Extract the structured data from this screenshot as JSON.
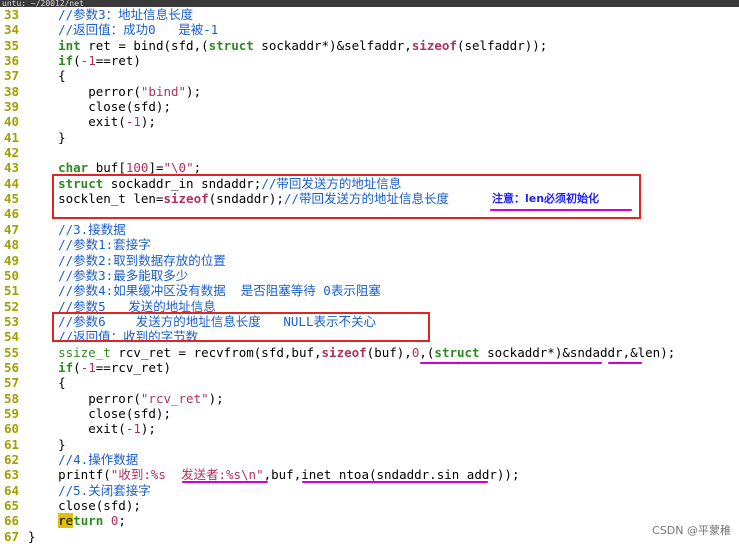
{
  "window": {
    "title": "untu: ~/20012/net"
  },
  "colors": {
    "line_number": "#a0a000",
    "comment": "#1a5fd0",
    "keyword": "#2e8b20",
    "string": "#b03060",
    "annotation_box": "#e02424",
    "annotation_underline": "#d000d0",
    "note_text": "#2020ff"
  },
  "lines": [
    {
      "n": "33",
      "segs": [
        [
          "t",
          "    "
        ],
        [
          "c",
          "//参数3：地址信息长度"
        ]
      ]
    },
    {
      "n": "34",
      "segs": [
        [
          "t",
          "    "
        ],
        [
          "c",
          "//返回值：成功0   是被-1"
        ]
      ]
    },
    {
      "n": "35",
      "segs": [
        [
          "t",
          "    "
        ],
        [
          "k",
          "int"
        ],
        [
          "t",
          " ret = bind(sfd,("
        ],
        [
          "k",
          "struct"
        ],
        [
          "t",
          " sockaddr*)&selfaddr,"
        ],
        [
          "f",
          "sizeof"
        ],
        [
          "t",
          "(selfaddr));"
        ]
      ]
    },
    {
      "n": "36",
      "segs": [
        [
          "t",
          "    "
        ],
        [
          "k",
          "if"
        ],
        [
          "t",
          "("
        ],
        [
          "n",
          "-1"
        ],
        [
          "t",
          "==ret)"
        ]
      ]
    },
    {
      "n": "37",
      "segs": [
        [
          "t",
          "    {"
        ]
      ]
    },
    {
      "n": "38",
      "segs": [
        [
          "t",
          "        perror("
        ],
        [
          "s",
          "\"bind\""
        ],
        [
          "t",
          ");"
        ]
      ]
    },
    {
      "n": "39",
      "segs": [
        [
          "t",
          "        close(sfd);"
        ]
      ]
    },
    {
      "n": "40",
      "segs": [
        [
          "t",
          "        exit("
        ],
        [
          "n",
          "-1"
        ],
        [
          "t",
          ");"
        ]
      ]
    },
    {
      "n": "41",
      "segs": [
        [
          "t",
          "    }"
        ]
      ]
    },
    {
      "n": "42",
      "segs": []
    },
    {
      "n": "43",
      "segs": [
        [
          "t",
          "    "
        ],
        [
          "k",
          "char"
        ],
        [
          "t",
          " buf["
        ],
        [
          "n",
          "100"
        ],
        [
          "t",
          "]="
        ],
        [
          "s",
          "\"\\0\""
        ],
        [
          "t",
          ";"
        ]
      ]
    },
    {
      "n": "44",
      "segs": [
        [
          "t",
          "    "
        ],
        [
          "k",
          "struct"
        ],
        [
          "t",
          " sockaddr_in sndaddr;"
        ],
        [
          "c",
          "//带回发送方的地址信息"
        ]
      ]
    },
    {
      "n": "45",
      "segs": [
        [
          "t",
          "    socklen_t len="
        ],
        [
          "f",
          "sizeof"
        ],
        [
          "t",
          "(sndaddr);"
        ],
        [
          "c",
          "//带回发送方的地址信息长度"
        ]
      ]
    },
    {
      "n": "46",
      "segs": []
    },
    {
      "n": "47",
      "segs": [
        [
          "t",
          "    "
        ],
        [
          "c",
          "//3.接数据"
        ]
      ]
    },
    {
      "n": "48",
      "segs": [
        [
          "t",
          "    "
        ],
        [
          "c",
          "//参数1:套接字"
        ]
      ]
    },
    {
      "n": "49",
      "segs": [
        [
          "t",
          "    "
        ],
        [
          "c",
          "//参数2:取到数据存放的位置"
        ]
      ]
    },
    {
      "n": "50",
      "segs": [
        [
          "t",
          "    "
        ],
        [
          "c",
          "//参数3:最多能取多少"
        ]
      ]
    },
    {
      "n": "51",
      "segs": [
        [
          "t",
          "    "
        ],
        [
          "c",
          "//参数4:如果缓冲区没有数据  是否阻塞等待 0表示阻塞"
        ]
      ]
    },
    {
      "n": "52",
      "segs": [
        [
          "t",
          "    "
        ],
        [
          "c",
          "//参数5   发送的地址信息"
        ]
      ]
    },
    {
      "n": "53",
      "segs": [
        [
          "t",
          "    "
        ],
        [
          "c",
          "//参数6    发送方的地址信息长度   NULL表示不关心"
        ]
      ]
    },
    {
      "n": "54",
      "segs": [
        [
          "t",
          "    "
        ],
        [
          "c",
          "//返回值：收到的字节数"
        ]
      ]
    },
    {
      "n": "55",
      "segs": [
        [
          "t",
          "    "
        ],
        [
          "y",
          "ssize_t"
        ],
        [
          "t",
          " rcv_ret = recvfrom(sfd,buf,"
        ],
        [
          "f",
          "sizeof"
        ],
        [
          "t",
          "(buf),"
        ],
        [
          "n",
          "0"
        ],
        [
          "t",
          ",("
        ],
        [
          "k",
          "struct"
        ],
        [
          "t",
          " sockaddr*)&sndaddr,&len);"
        ]
      ]
    },
    {
      "n": "56",
      "segs": [
        [
          "t",
          "    "
        ],
        [
          "k",
          "if"
        ],
        [
          "t",
          "("
        ],
        [
          "n",
          "-1"
        ],
        [
          "t",
          "==rcv_ret)"
        ]
      ]
    },
    {
      "n": "57",
      "segs": [
        [
          "t",
          "    {"
        ]
      ]
    },
    {
      "n": "58",
      "segs": [
        [
          "t",
          "        perror("
        ],
        [
          "s",
          "\"rcv_ret\""
        ],
        [
          "t",
          ");"
        ]
      ]
    },
    {
      "n": "59",
      "segs": [
        [
          "t",
          "        close(sfd);"
        ]
      ]
    },
    {
      "n": "60",
      "segs": [
        [
          "t",
          "        exit("
        ],
        [
          "n",
          "-1"
        ],
        [
          "t",
          ");"
        ]
      ]
    },
    {
      "n": "61",
      "segs": [
        [
          "t",
          "    }"
        ]
      ]
    },
    {
      "n": "62",
      "segs": [
        [
          "t",
          "    "
        ],
        [
          "c",
          "//4.操作数据"
        ]
      ]
    },
    {
      "n": "63",
      "segs": [
        [
          "t",
          "    printf("
        ],
        [
          "s",
          "\"收到:%s  发送者:%s\\n\""
        ],
        [
          "t",
          ",buf,inet_ntoa(sndaddr.sin_addr));"
        ]
      ]
    },
    {
      "n": "64",
      "segs": [
        [
          "t",
          "    "
        ],
        [
          "c",
          "//5.关闭套接字"
        ]
      ]
    },
    {
      "n": "65",
      "segs": [
        [
          "t",
          "    close(sfd);"
        ]
      ]
    },
    {
      "n": "66",
      "segs": [
        [
          "t",
          "    "
        ],
        [
          "r",
          "re"
        ],
        [
          "k",
          "turn"
        ],
        [
          "t",
          " "
        ],
        [
          "n",
          "0"
        ],
        [
          "t",
          ";"
        ]
      ]
    },
    {
      "n": "67",
      "segs": [
        [
          "t",
          "}"
        ]
      ]
    }
  ],
  "annotations": {
    "note": "注意：len必须初始化"
  },
  "watermark": "CSDN @平蒙稚"
}
